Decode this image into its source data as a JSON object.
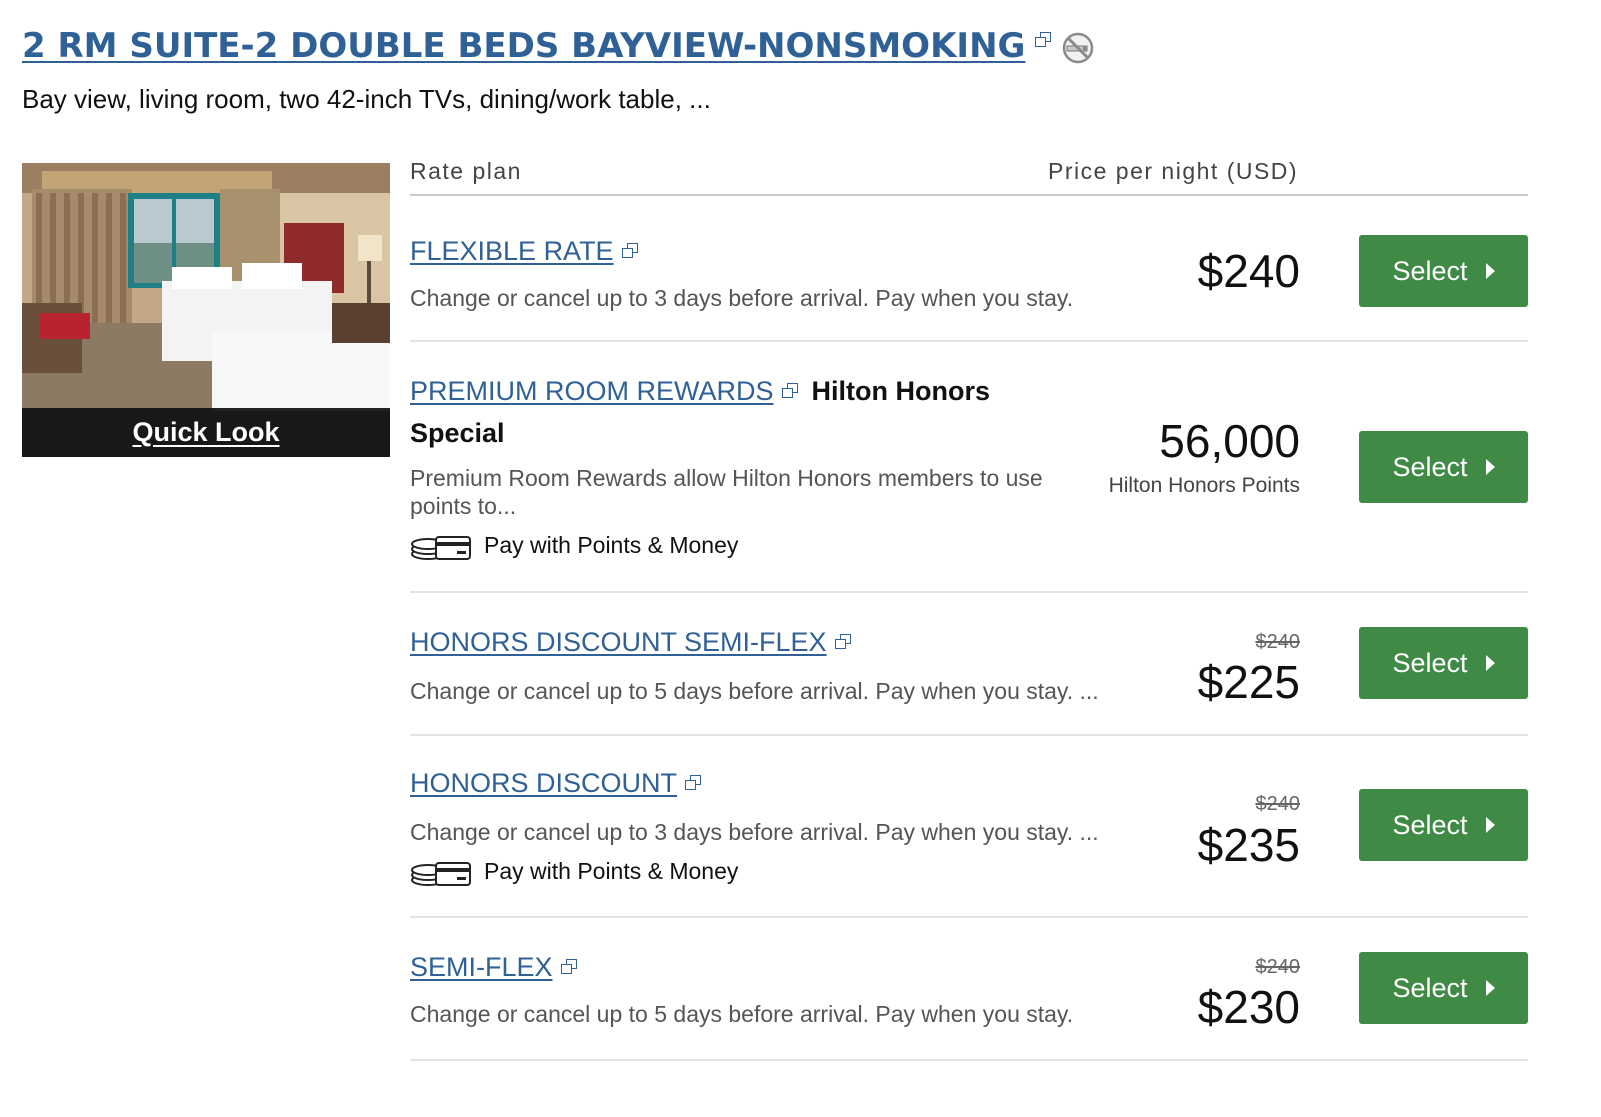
{
  "room": {
    "title": "2 RM SUITE-2 DOUBLE BEDS BAYVIEW-NONSMOKING",
    "description": "Bay view, living room, two 42-inch TVs, dining/work table, ...",
    "quick_look_label": "Quick Look",
    "icons": [
      "external-link-icon",
      "no-smoking-icon"
    ]
  },
  "table_header": {
    "rate_plan": "Rate plan",
    "price_per_night": "Price per night (USD)"
  },
  "rates": [
    {
      "name": "FLEXIBLE RATE",
      "description": "Change or cancel up to 3 days before arrival. Pay when you stay.",
      "price": "$240",
      "select_label": "Select"
    },
    {
      "name": "PREMIUM ROOM REWARDS",
      "badge": "Hilton Honors",
      "badge_line2": "Special",
      "description": "Premium Room Rewards allow Hilton Honors members to use points to...",
      "points_money": "Pay with Points & Money",
      "price": "56,000",
      "price_unit": "Hilton Honors Points",
      "select_label": "Select"
    },
    {
      "name": "HONORS DISCOUNT SEMI-FLEX",
      "description": "Change or cancel up to 5 days before arrival. Pay when you stay. ...",
      "original_price": "$240",
      "price": "$225",
      "select_label": "Select"
    },
    {
      "name": "HONORS DISCOUNT",
      "description": "Change or cancel up to 3 days before arrival. Pay when you stay. ...",
      "points_money": "Pay with Points & Money",
      "original_price": "$240",
      "price": "$235",
      "select_label": "Select"
    },
    {
      "name": "SEMI-FLEX",
      "description": "Change or cancel up to 5 days before arrival. Pay when you stay.",
      "original_price": "$240",
      "price": "$230",
      "select_label": "Select"
    }
  ],
  "colors": {
    "link": "#2f6196",
    "button": "#3f8a44",
    "divider": "#e4e4e4"
  }
}
